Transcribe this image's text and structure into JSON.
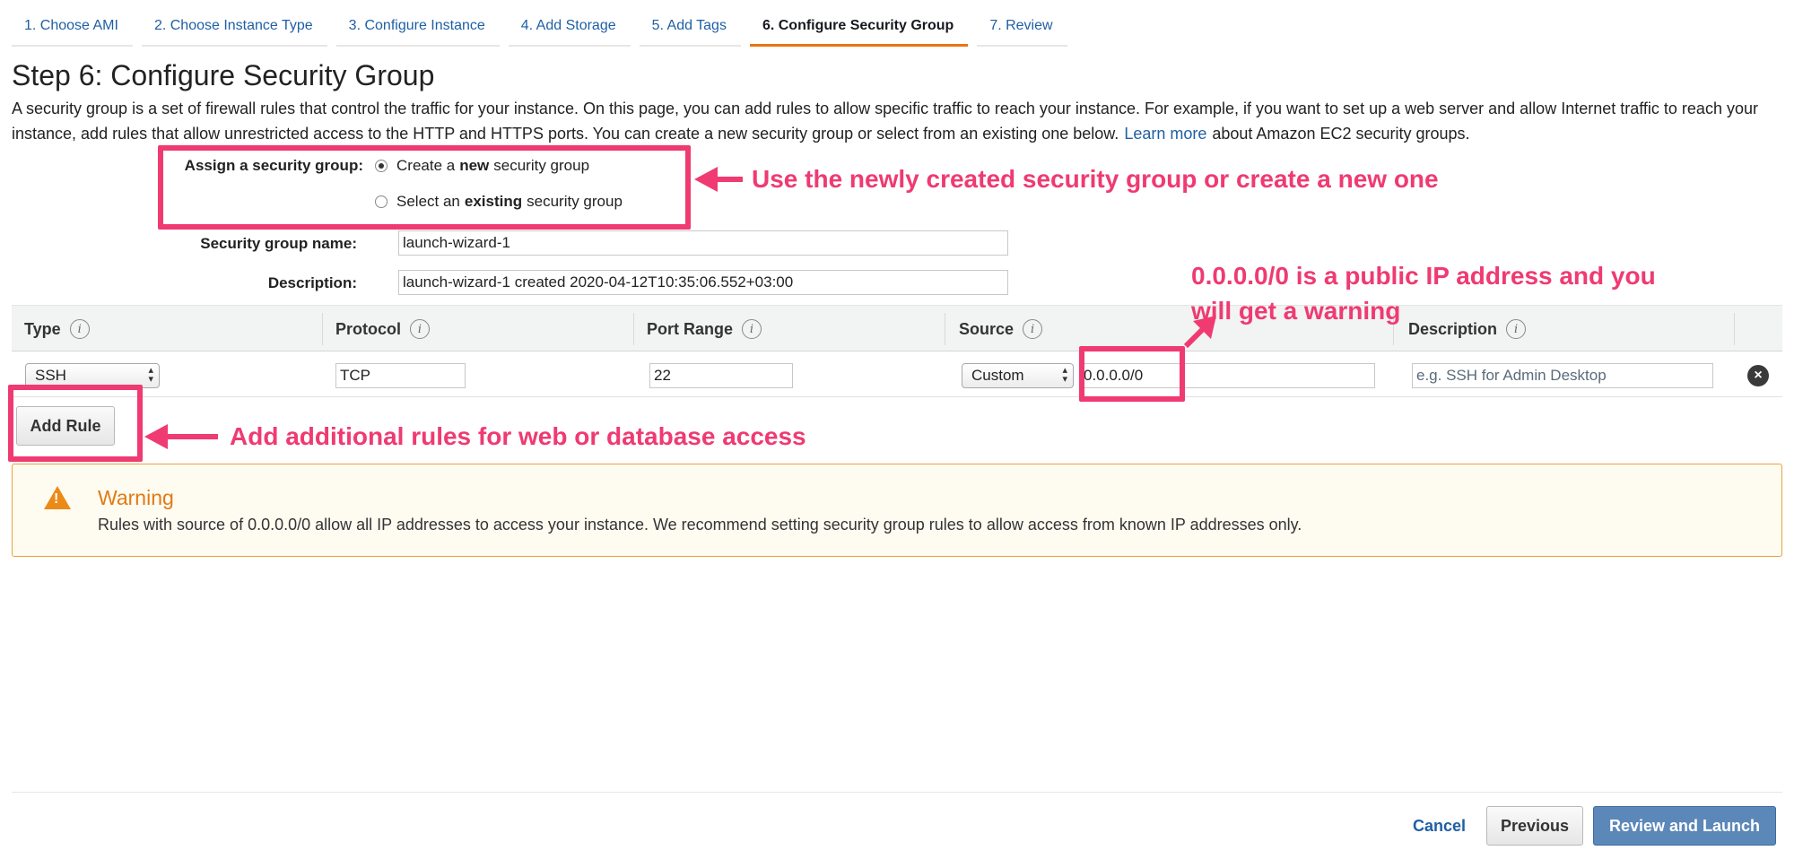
{
  "wizard": {
    "tabs": [
      {
        "label": "1. Choose AMI"
      },
      {
        "label": "2. Choose Instance Type"
      },
      {
        "label": "3. Configure Instance"
      },
      {
        "label": "4. Add Storage"
      },
      {
        "label": "5. Add Tags"
      },
      {
        "label": "6. Configure Security Group"
      },
      {
        "label": "7. Review"
      }
    ],
    "active_tab": "6. Configure Security Group"
  },
  "page": {
    "title": "Step 6: Configure Security Group",
    "intro_text": "A security group is a set of firewall rules that control the traffic for your instance. On this page, you can add rules to allow specific traffic to reach your instance. For example, if you want to set up a web server and allow Internet traffic to reach your instance, add rules that allow unrestricted access to the HTTP and HTTPS ports. You can create a new security group or select from an existing one below.",
    "learn_more": "Learn more",
    "intro_suffix": "about Amazon EC2 security groups."
  },
  "assign": {
    "label": "Assign a security group:",
    "options": [
      {
        "pre": "Create a",
        "bold": "new",
        "post": "security group",
        "selected": true
      },
      {
        "pre": "Select an",
        "bold": "existing",
        "post": "security group",
        "selected": false
      }
    ]
  },
  "group": {
    "name_label": "Security group name:",
    "name_value": "launch-wizard-1",
    "desc_label": "Description:",
    "desc_value": "launch-wizard-1 created 2020-04-12T10:35:06.552+03:00"
  },
  "rules": {
    "columns": [
      "Type",
      "Protocol",
      "Port Range",
      "Source",
      "Description"
    ],
    "rows": [
      {
        "type": "SSH",
        "protocol": "TCP",
        "port_range": "22",
        "source_type": "Custom",
        "source_value": "0.0.0.0/0",
        "description_placeholder": "e.g. SSH for Admin Desktop"
      }
    ],
    "add_rule_label": "Add Rule"
  },
  "warning": {
    "title": "Warning",
    "text": "Rules with source of 0.0.0.0/0 allow all IP addresses to access your instance. We recommend setting security group rules to allow access from known IP addresses only."
  },
  "footer": {
    "cancel": "Cancel",
    "previous": "Previous",
    "review_launch": "Review and Launch"
  },
  "annotations": {
    "assign_note": "Use the newly created security group or create a new one",
    "source_note_line1": "0.0.0.0/0 is a public IP address and you",
    "source_note_line2": "will get a warning",
    "add_rule_note": "Add additional rules for web or database access",
    "color": "#ef3a72"
  },
  "colors": {
    "link": "#1f5fa4",
    "active_tab_underline": "#ec7211",
    "warning_accent": "#e07b13",
    "primary_button": "#5c88b9"
  }
}
